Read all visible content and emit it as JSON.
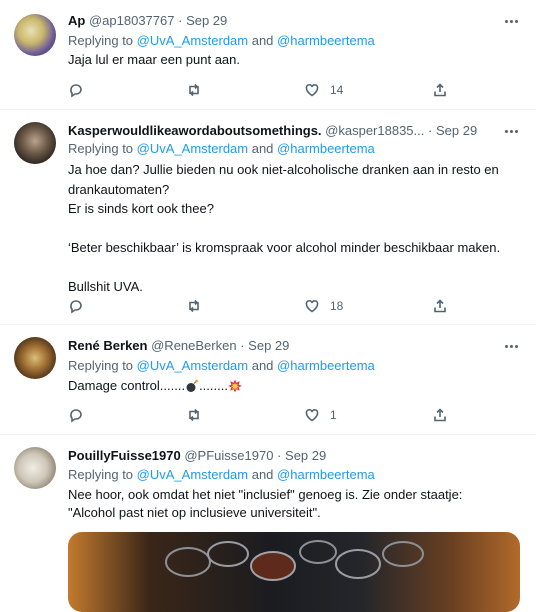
{
  "tweets": [
    {
      "name": "Ap",
      "handle": "@ap18037767",
      "dot": "·",
      "date": "Sep 29",
      "replying_prefix": "Replying to ",
      "mention1": "@UvA_Amsterdam",
      "and": " and ",
      "mention2": "@harmbeertema",
      "text": "Jaja lul er maar een punt aan.",
      "likes": "14"
    },
    {
      "name": "Kasperwouldlikeawordaboutsomethings.",
      "handle": "@kasper18835...",
      "dot": "·",
      "date": "Sep 29",
      "replying_prefix": "Replying to ",
      "mention1": "@UvA_Amsterdam",
      "and": " and ",
      "mention2": "@harmbeertema",
      "text": "Ja hoe dan? Jullie bieden nu ook niet-alcoholische dranken aan in resto en drankautomaten?\nEr is sinds kort ook thee?\n\n‘Beter beschikbaar’ is kromspraak voor alcohol minder beschikbaar maken.\n\nBullshit UVA.",
      "likes": "18"
    },
    {
      "name": "René Berken",
      "handle": "@ReneBerken",
      "dot": "·",
      "date": "Sep 29",
      "replying_prefix": "Replying to ",
      "mention1": "@UvA_Amsterdam",
      "and": " and ",
      "mention2": "@harmbeertema",
      "text_a": "Damage control.......",
      "text_b": "........",
      "emoji1": "bomb-emoji",
      "emoji2": "collision-emoji",
      "likes": "1"
    },
    {
      "name": "PouillyFuisse1970",
      "handle": "@PFuisse1970",
      "dot": "·",
      "date": "Sep 29",
      "replying_prefix": "Replying to ",
      "mention1": "@UvA_Amsterdam",
      "and": " and ",
      "mention2": "@harmbeertema",
      "text": "Nee hoor, ook omdat het niet \"inclusief\" genoeg is. Zie onder staatje:\n\"Alcohol past niet op inclusieve universiteit\"."
    }
  ],
  "icons": {
    "reply": "reply-icon",
    "retweet": "retweet-icon",
    "like": "like-icon",
    "share": "share-icon",
    "more": "more-icon"
  },
  "colors": {
    "accent": "#1d9bf0",
    "muted": "#536471",
    "text": "#0f1419"
  }
}
